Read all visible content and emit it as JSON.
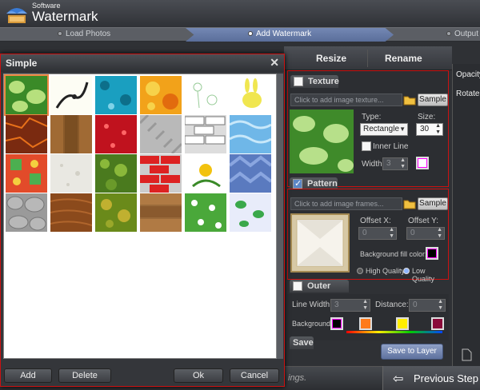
{
  "app": {
    "title_small": "Software",
    "title_large": "Watermark"
  },
  "steps": [
    {
      "label": "Load Photos"
    },
    {
      "label": "Add Watermark"
    },
    {
      "label": "Output"
    }
  ],
  "tabs": {
    "resize": "Resize",
    "rename": "Rename"
  },
  "right_panel": {
    "opacity": "Opacity",
    "rotate": "Rotate"
  },
  "texture": {
    "header": "Texture",
    "placeholder": "Click to add image texture...",
    "sample": "Sample",
    "type_label": "Type:",
    "type_value": "Rectangle",
    "size_label": "Size:",
    "size_value": "30",
    "inner_line_label": "Inner Line",
    "width_label": "Width:",
    "width_value": "3"
  },
  "pattern": {
    "header": "Pattern",
    "placeholder": "Click to add image frames...",
    "sample": "Sample",
    "offset_x_label": "Offset X:",
    "offset_x_value": "0",
    "offset_y_label": "Offset Y:",
    "offset_y_value": "0",
    "bg_fill_label": "Background fill color:",
    "high_quality": "High Quality",
    "low_quality": "Low Quality"
  },
  "outer_line": {
    "header": "Outer Line",
    "line_width_label": "Line Width:",
    "line_width_value": "3",
    "distance_label": "Distance:",
    "distance_value": "0",
    "background_label": "Background",
    "colors": [
      "#000000",
      "#ff7a1a",
      "#ffee00",
      "#8a0a3a"
    ]
  },
  "save_section": {
    "header": "Save"
  },
  "save_to_layer": "Save to Layer",
  "bottom": {
    "prev_step": "Previous Step",
    "partial_text": "ings."
  },
  "dialog": {
    "title": "Simple",
    "buttons": {
      "add": "Add",
      "delete": "Delete",
      "ok": "Ok",
      "cancel": "Cancel"
    },
    "tiles": [
      [
        "green-leaves",
        "tribal-flourish",
        "teal-pattern",
        "orange-swirl",
        "flower-sketch",
        "yellow-bunny"
      ],
      [
        "lava-rock",
        "wood-planks",
        "red-floral",
        "gray-herringbone",
        "white-bricks",
        "blue-water"
      ],
      [
        "colorful-geometric",
        "white-stucco",
        "green-moss",
        "red-bricks",
        "yellow-lilies",
        "blue-chevron"
      ],
      [
        "gray-cobblestone",
        "wood-grain",
        "green-lichen",
        "wood-boards",
        "green-daisies",
        "green-frogs"
      ]
    ]
  }
}
